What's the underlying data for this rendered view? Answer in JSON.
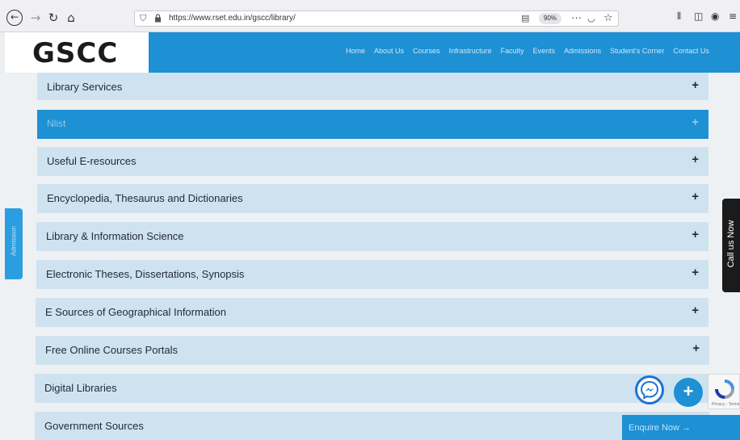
{
  "browser": {
    "url": "https://www.rset.edu.in/gscc/library/",
    "zoom": "90%",
    "more_glyph": "···"
  },
  "site": {
    "logo": "GSCC",
    "nav": [
      "Home",
      "About Us",
      "Courses",
      "Infrastructure",
      "Faculty",
      "Events",
      "Admissions",
      "Student's Corner",
      "Contact Us"
    ]
  },
  "accordion": [
    {
      "label": "Library Services",
      "active": false
    },
    {
      "label": "Nlist",
      "active": true
    },
    {
      "label": "Useful E-resources",
      "active": false
    },
    {
      "label": "Encyclopedia, Thesaurus and Dictionaries",
      "active": false
    },
    {
      "label": "Library & Information Science",
      "active": false
    },
    {
      "label": "Electronic Theses, Dissertations, Synopsis",
      "active": false
    },
    {
      "label": "E Sources of Geographical Information",
      "active": false
    },
    {
      "label": "Free Online Courses Portals",
      "active": false
    },
    {
      "label": "Digital Libraries",
      "active": false
    },
    {
      "label": "Government Sources",
      "active": false
    }
  ],
  "accordion_icon": "+",
  "widgets": {
    "side_tab_left": "Admission",
    "call_us": "Call us Now",
    "enquire": "Enquire Now  →",
    "fab_plus": "+",
    "recaptcha_text": "Privacy - Terms"
  },
  "colors": {
    "accent": "#1e90d4",
    "accordion_bg": "#cfe2ef"
  }
}
